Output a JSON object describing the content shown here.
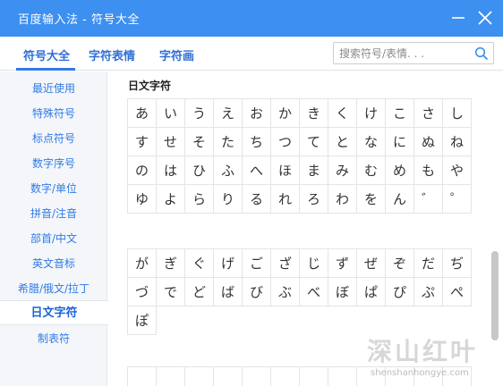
{
  "window": {
    "title": "百度输入法 - 符号大全"
  },
  "tabs": [
    {
      "label": "符号大全",
      "active": true
    },
    {
      "label": "字符表情",
      "active": false
    },
    {
      "label": "字符画",
      "active": false
    }
  ],
  "search": {
    "placeholder": "搜索符号/表情. . ."
  },
  "sidebar": {
    "items": [
      {
        "label": "最近使用"
      },
      {
        "label": "特殊符号"
      },
      {
        "label": "标点符号"
      },
      {
        "label": "数字序号"
      },
      {
        "label": "数字/单位"
      },
      {
        "label": "拼音/注音"
      },
      {
        "label": "部首/中文"
      },
      {
        "label": "英文音标"
      },
      {
        "label": "希腊/俄文/拉丁"
      },
      {
        "label": "日文字符",
        "active": true
      },
      {
        "label": "制表符"
      }
    ]
  },
  "content": {
    "section_title": "日文字符",
    "hiragana": [
      "あ",
      "い",
      "う",
      "え",
      "お",
      "か",
      "き",
      "く",
      "け",
      "こ",
      "さ",
      "し",
      "す",
      "せ",
      "そ",
      "た",
      "ち",
      "つ",
      "て",
      "と",
      "な",
      "に",
      "ぬ",
      "ね",
      "の",
      "は",
      "ひ",
      "ふ",
      "へ",
      "ほ",
      "ま",
      "み",
      "む",
      "め",
      "も",
      "や",
      "ゆ",
      "よ",
      "ら",
      "り",
      "る",
      "れ",
      "ろ",
      "わ",
      "を",
      "ん",
      "゛",
      "゜"
    ],
    "dakuten": [
      "が",
      "ぎ",
      "ぐ",
      "げ",
      "ご",
      "ざ",
      "じ",
      "ず",
      "ぜ",
      "ぞ",
      "だ",
      "ぢ",
      "づ",
      "で",
      "ど",
      "ば",
      "び",
      "ぶ",
      "べ",
      "ぼ",
      "ぱ",
      "ぴ",
      "ぷ",
      "ぺ",
      "ぽ"
    ]
  },
  "watermark": {
    "main": "深山红叶",
    "sub": "shenshanhongye.com"
  },
  "colors": {
    "titlebar": "#3d8ff0",
    "accent": "#2f7be8",
    "sidebar_bg": "#f4f6f9"
  },
  "icons": {
    "search": "search-icon",
    "minimize": "minimize-icon",
    "close": "close-icon"
  }
}
